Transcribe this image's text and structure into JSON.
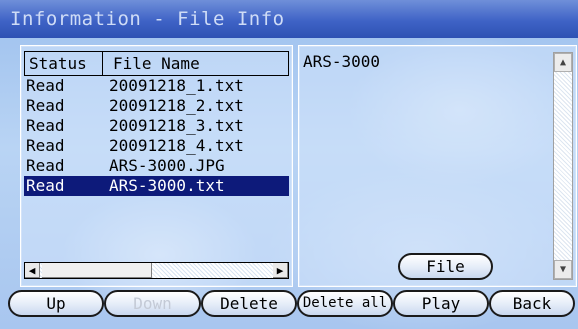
{
  "window": {
    "title": "Information - File Info"
  },
  "file_table": {
    "headers": {
      "status": "Status",
      "file_name": "File Name"
    },
    "rows": [
      {
        "status": "Read",
        "name": "20091218_1.txt"
      },
      {
        "status": "Read",
        "name": "20091218_2.txt"
      },
      {
        "status": "Read",
        "name": "20091218_3.txt"
      },
      {
        "status": "Read",
        "name": "20091218_4.txt"
      },
      {
        "status": "Read",
        "name": "ARS-3000.JPG"
      },
      {
        "status": "Read",
        "name": "ARS-3000.txt"
      }
    ],
    "selected_index": 5
  },
  "icons": {
    "scroll_left": "scroll-left-icon",
    "scroll_right": "scroll-right-icon",
    "scroll_up": "scroll-up-icon",
    "scroll_down": "scroll-down-icon"
  },
  "scroll_glyphs": {
    "left": "◀",
    "right": "▶",
    "up": "▲",
    "down": "▼"
  },
  "preview": {
    "content": "ARS-3000",
    "file_button": "File"
  },
  "buttons": {
    "up": "Up",
    "down": "Down",
    "delete": "Delete",
    "delete_all": "Delete all",
    "play": "Play",
    "back": "Back"
  },
  "colors": {
    "title_bar": "#3f63c6",
    "selection": "#0d1a7a",
    "disabled_text": "#c4cad6"
  }
}
